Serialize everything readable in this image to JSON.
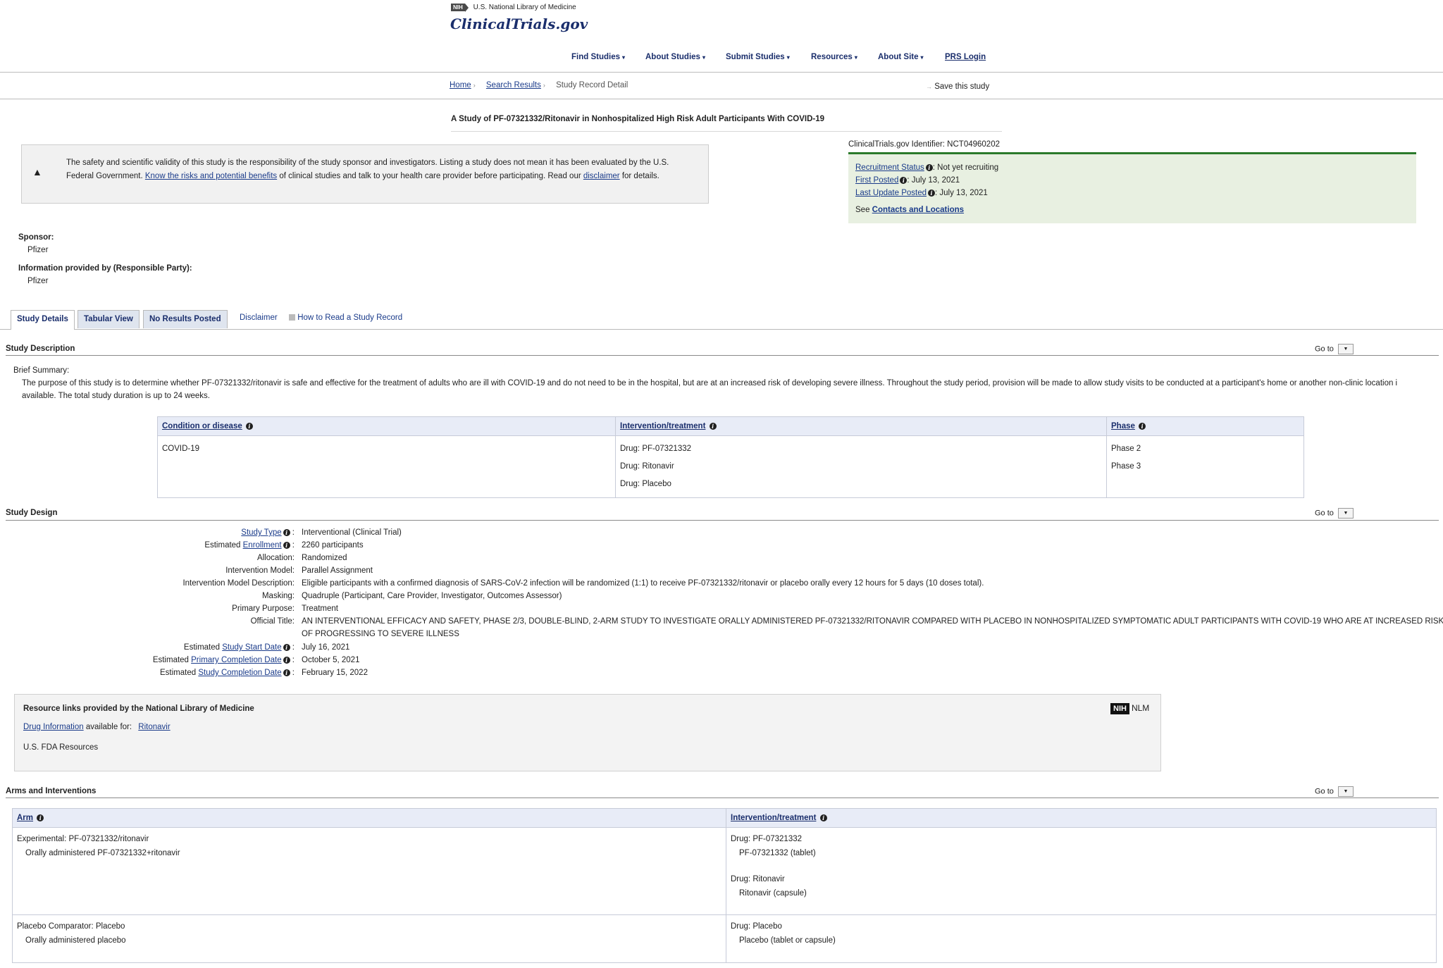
{
  "header": {
    "nih_badge": "NIH",
    "nlm_text": "U.S. National Library of Medicine",
    "site_name": "ClinicalTrials.gov"
  },
  "nav": {
    "items": [
      "Find Studies",
      "About Studies",
      "Submit Studies",
      "Resources",
      "About Site"
    ],
    "prs_login": "PRS Login"
  },
  "breadcrumb": {
    "home": "Home",
    "search_results": "Search Results",
    "current": "Study Record Detail",
    "save": "Save this study"
  },
  "study_title": "A Study of PF-07321332/Ritonavir in Nonhospitalized High Risk Adult Participants With COVID-19",
  "alert": {
    "text_1": "The safety and scientific validity of this study is the responsibility of the study sponsor and investigators. Listing a study does not mean it has been evaluated by the U.S. Federal Government. ",
    "link_1": "Know the risks and potential benefits",
    "text_2": " of clinical studies and talk to your health care provider before participating. Read our ",
    "link_2": "disclaimer",
    "text_3": " for details."
  },
  "status": {
    "identifier": "ClinicalTrials.gov Identifier: NCT04960202",
    "recruitment_label": "Recruitment Status",
    "recruitment_value": ": Not yet recruiting",
    "first_posted_label": "First Posted",
    "first_posted_value": ": July 13, 2021",
    "last_update_label": "Last Update Posted",
    "last_update_value": ": July 13, 2021",
    "see": "See ",
    "contacts_link": "Contacts and Locations"
  },
  "sponsor": {
    "label": "Sponsor:",
    "value": "Pfizer",
    "info_label": "Information provided by (Responsible Party):",
    "info_value": "Pfizer"
  },
  "tabs": {
    "study_details": "Study Details",
    "tabular_view": "Tabular View",
    "no_results": "No Results Posted",
    "disclaimer": "Disclaimer",
    "how_to_read": "How to Read a Study Record"
  },
  "goto_label": "Go to",
  "description": {
    "section_title": "Study Description",
    "brief_label": "Brief Summary:",
    "brief_line1": "The purpose of this study is to determine whether PF-07321332/ritonavir is safe and effective for the treatment of adults who are ill with COVID-19 and do not need to be in the hospital, but are at an increased risk of developing severe illness. Throughout the study period, provision will be made to allow study visits to be conducted at a participant's home or another non-clinic location i",
    "brief_line2": "available. The total study duration is up to 24 weeks.",
    "table": {
      "headers": [
        "Condition or disease",
        "Intervention/treatment",
        "Phase"
      ],
      "condition": "COVID-19",
      "interventions": [
        "Drug: PF-07321332",
        "Drug: Ritonavir",
        "Drug: Placebo"
      ],
      "phases": [
        "Phase 2",
        "Phase 3"
      ]
    }
  },
  "design": {
    "section_title": "Study Design",
    "rows": [
      {
        "pre": "",
        "link": "Study Type",
        "value": "Interventional  (Clinical Trial)"
      },
      {
        "pre": "Estimated ",
        "link": "Enrollment",
        "value": "2260 participants"
      },
      {
        "pre": "Allocation:",
        "link": "",
        "value": "Randomized"
      },
      {
        "pre": "Intervention Model:",
        "link": "",
        "value": "Parallel Assignment"
      },
      {
        "pre": "Intervention Model Description:",
        "link": "",
        "value": "Eligible participants with a confirmed diagnosis of SARS-CoV-2 infection will be randomized (1:1) to receive PF-07321332/ritonavir or placebo orally every 12 hours for 5 days (10 doses total)."
      },
      {
        "pre": "Masking:",
        "link": "",
        "value": "Quadruple (Participant, Care Provider, Investigator, Outcomes Assessor)"
      },
      {
        "pre": "Primary Purpose:",
        "link": "",
        "value": "Treatment"
      },
      {
        "pre": "Official Title:",
        "link": "",
        "value": "AN INTERVENTIONAL EFFICACY AND SAFETY, PHASE 2/3, DOUBLE-BLIND, 2-ARM STUDY TO INVESTIGATE ORALLY ADMINISTERED PF-07321332/RITONAVIR COMPARED WITH PLACEBO IN NONHOSPITALIZED SYMPTOMATIC ADULT PARTICIPANTS WITH COVID-19 WHO ARE AT INCREASED RISK",
        "value2": "OF PROGRESSING TO SEVERE ILLNESS"
      },
      {
        "pre": "Estimated ",
        "link": "Study Start Date",
        "value": "July 16, 2021"
      },
      {
        "pre": "Estimated ",
        "link": "Primary Completion Date",
        "value": "October 5, 2021"
      },
      {
        "pre": "Estimated ",
        "link": "Study Completion Date",
        "value": "February 15, 2022"
      }
    ]
  },
  "resources": {
    "title": "Resource links provided by the National Library of Medicine",
    "drug_info_link": "Drug Information",
    "available_for": " available for: ",
    "ritonavir_link": "Ritonavir",
    "fda_link": "U.S. FDA Resources",
    "nlm_badge": "NIH",
    "nlm_text": "NLM"
  },
  "arms": {
    "section_title": "Arms and Interventions",
    "headers": [
      "Arm",
      "Intervention/treatment"
    ],
    "rows": [
      {
        "arm": "Experimental: PF-07321332/ritonavir",
        "arm_desc": "Orally administered PF-07321332+ritonavir",
        "drug1": "Drug: PF-07321332",
        "drug1_desc": "PF-07321332 (tablet)",
        "drug2": "Drug: Ritonavir",
        "drug2_desc": "Ritonavir (capsule)"
      },
      {
        "arm": "Placebo Comparator: Placebo",
        "arm_desc": "Orally administered placebo",
        "drug1": "Drug: Placebo",
        "drug1_desc": "Placebo (tablet or capsule)"
      }
    ]
  }
}
